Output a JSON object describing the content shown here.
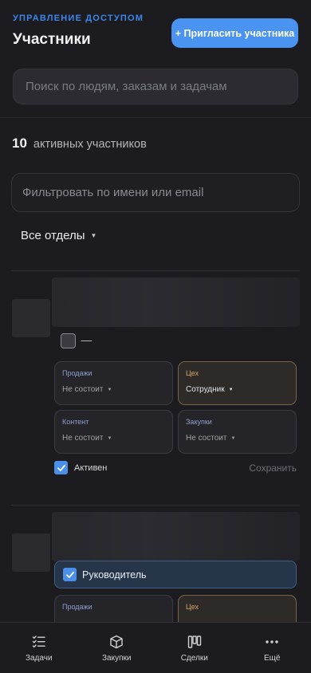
{
  "header": {
    "eyebrow": "УПРАВЛЕНИЕ ДОСТУПОМ",
    "title": "Участники",
    "invite_label": "+ Пригласить участника"
  },
  "search": {
    "placeholder": "Поиск по людям, заказам и задачам"
  },
  "summary": {
    "count": "10",
    "label": "активных участников"
  },
  "filter": {
    "placeholder": "Фильтровать по имени или email"
  },
  "department": {
    "selected": "Все отделы"
  },
  "members": [
    {
      "manager_text": "—",
      "roles": [
        {
          "dept": "Продажи",
          "value": "Не состоит"
        },
        {
          "dept": "Цех",
          "value": "Сотрудник"
        },
        {
          "dept": "Контент",
          "value": "Не состоит"
        },
        {
          "dept": "Закупки",
          "value": "Не состоит"
        }
      ],
      "active_label": "Активен",
      "save_label": "Сохранить"
    },
    {
      "manager_label": "Руководитель",
      "roles": [
        {
          "dept": "Продажи"
        },
        {
          "dept": "Цех"
        }
      ]
    }
  ],
  "tabs": [
    {
      "label": "Задачи",
      "icon": "tasks-icon"
    },
    {
      "label": "Закупки",
      "icon": "box-icon"
    },
    {
      "label": "Сделки",
      "icon": "kanban-icon"
    },
    {
      "label": "Ещё",
      "icon": "more-icon"
    }
  ]
}
